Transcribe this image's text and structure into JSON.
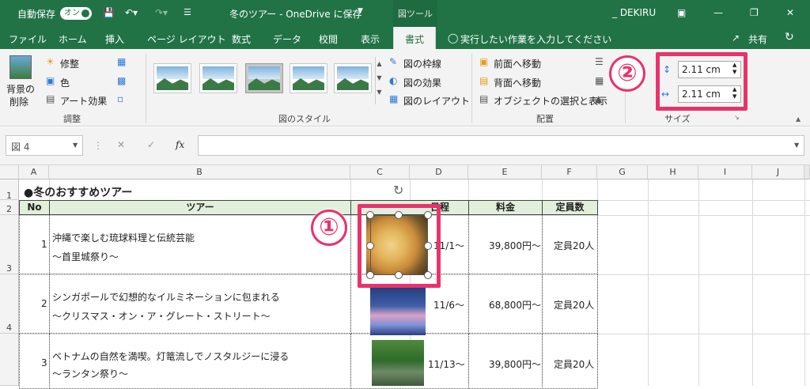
{
  "titlebar": {
    "autosave_label": "自動保存",
    "autosave_toggle": "オン",
    "doc_title": "冬のツアー - OneDrive に保存",
    "context_tab_header": "図ツール",
    "user": "_ DEKIRU"
  },
  "tabs": [
    "ファイル",
    "ホーム",
    "挿入",
    "ページ レイアウト",
    "数式",
    "データ",
    "校閲",
    "表示",
    "書式"
  ],
  "tell_me": "実行したい作業を入力してください",
  "share_label": "共有",
  "ribbon": {
    "adjust": {
      "remove_bg_1": "背景の",
      "remove_bg_2": "削除",
      "corrections": "修整",
      "color": "色",
      "artistic": "アート効果",
      "group": "調整"
    },
    "styles": {
      "border": "図の枠線",
      "effects": "図の効果",
      "layout": "図のレイアウト",
      "group": "図のスタイル"
    },
    "arrange": {
      "bring_forward": "前面へ移動",
      "send_backward": "背面へ移動",
      "selection_pane": "オブジェクトの選択と表示",
      "group": "配置"
    },
    "size": {
      "height": "2.11 cm",
      "width": "2.11 cm",
      "group": "サイズ"
    }
  },
  "formula_bar": {
    "name_box": "図 4",
    "fx": "fx"
  },
  "columns": [
    "A",
    "B",
    "C",
    "D",
    "E",
    "F",
    "G",
    "H",
    "I",
    "J"
  ],
  "rows": [
    "1",
    "2",
    "3",
    "4"
  ],
  "sheet": {
    "title": "●冬のおすすめツアー",
    "headers": {
      "no": "No",
      "tour": "ツアー",
      "date": "日程",
      "price": "料金",
      "capacity": "定員数"
    },
    "tours": [
      {
        "no": "1",
        "line1": "沖縄で楽しむ琉球料理と伝統芸能",
        "line2": "〜首里城祭り〜",
        "date": "11/1〜",
        "price": "39,800円〜",
        "capacity": "定員20人"
      },
      {
        "no": "2",
        "line1": "シンガポールで幻想的なイルミネーションに包まれる",
        "line2": "〜クリスマス・オン・ア・グレート・ストリート〜",
        "date": "11/6〜",
        "price": "68,800円〜",
        "capacity": "定員20人"
      },
      {
        "no": "3",
        "line1": "ベトナムの自然を満喫。灯篭流しでノスタルジーに浸る",
        "line2": "〜ランタン祭り〜",
        "date": "11/13〜",
        "price": "39,800円〜",
        "capacity": "定員20人"
      }
    ]
  },
  "callouts": {
    "one": "①",
    "two": "②"
  },
  "colors": {
    "excel_green": "#217346",
    "header_fill": "#e2efda",
    "callout_pink": "#e8336c"
  }
}
